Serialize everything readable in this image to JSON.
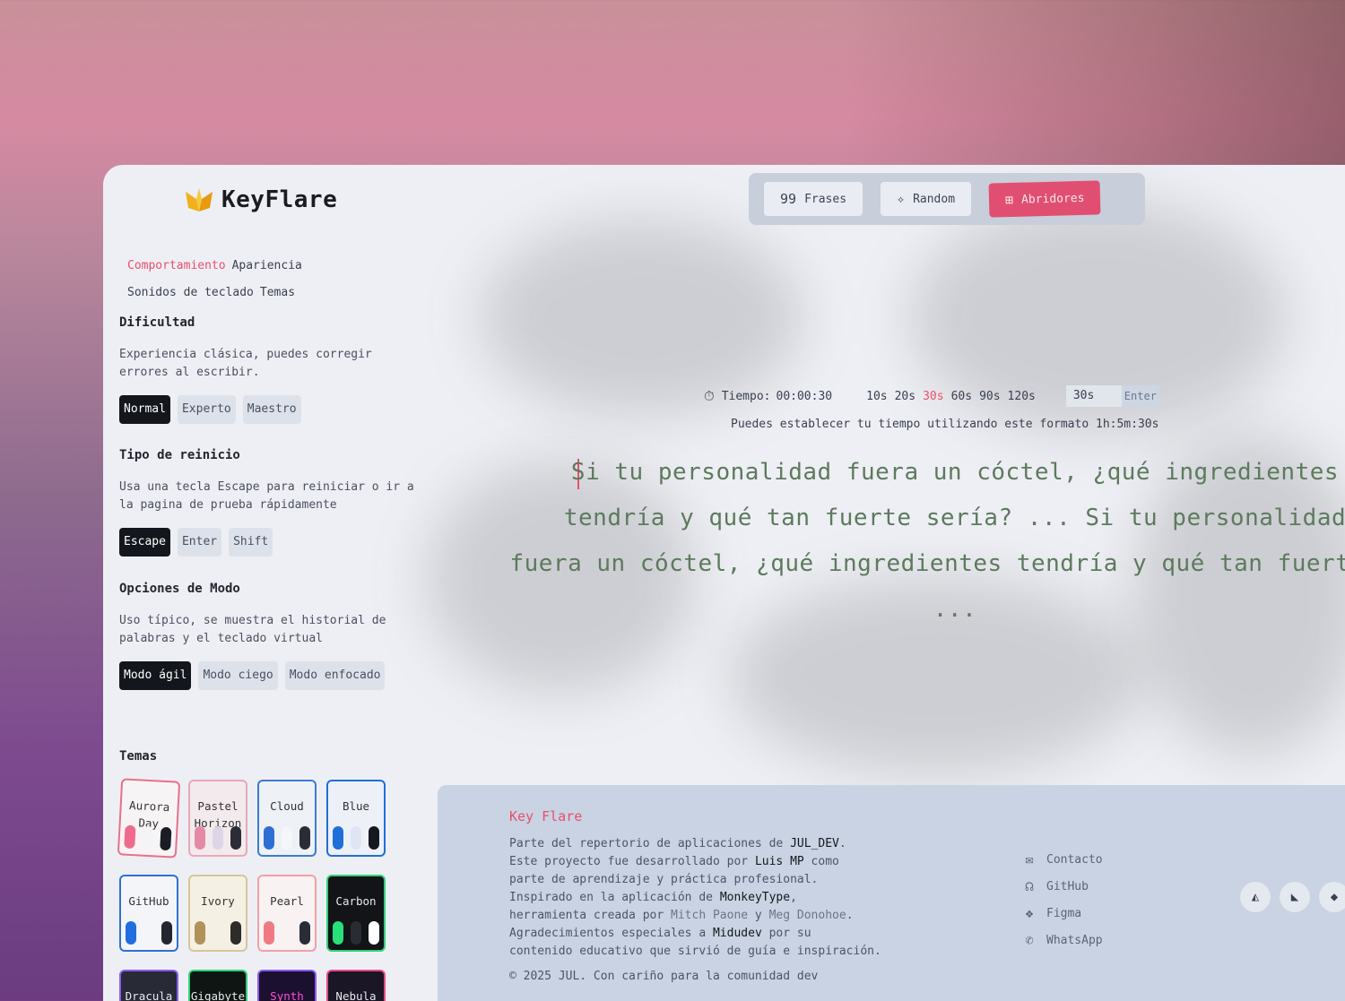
{
  "app": {
    "name": "KeyFlare"
  },
  "settings_nav": {
    "items": [
      "Comportamiento",
      "Apariencia",
      "Sonidos de teclado",
      "Temas"
    ],
    "active": "Comportamiento"
  },
  "difficulty": {
    "title": "Dificultad",
    "description": "Experiencia clásica, puedes corregir errores al escribir.",
    "options": [
      "Normal",
      "Experto",
      "Maestro"
    ],
    "selected": "Normal"
  },
  "restart": {
    "title": "Tipo de reinicio",
    "description": "Usa una tecla Escape para reiniciar o ir a la pagina de prueba rápidamente",
    "options": [
      "Escape",
      "Enter",
      "Shift"
    ],
    "selected": "Escape"
  },
  "mode_options": {
    "title": "Opciones de Modo",
    "description": "Uso típico, se muestra el historial de palabras y el teclado virtual",
    "options": [
      "Modo ágil",
      "Modo ciego",
      "Modo enfocado"
    ],
    "selected": "Modo ágil"
  },
  "themes": {
    "title": "Temas",
    "items": [
      {
        "name": "Aurora Day",
        "border": "#e8708a",
        "bg": "#f7f4f6",
        "swatches": [
          "#ef6b8e",
          "#f4f4f6",
          "#1b1d24"
        ]
      },
      {
        "name": "Pastel Horizon",
        "border": "#e8a8b8",
        "bg": "#f3eaee",
        "swatches": [
          "#e58aa6",
          "#dcd6e6",
          "#2a2c36"
        ]
      },
      {
        "name": "Cloud",
        "border": "#3a7bd5",
        "bg": "#eef1f6",
        "swatches": [
          "#2f6fd4",
          "#f4f6fa",
          "#2a2c36"
        ]
      },
      {
        "name": "Blue",
        "border": "#1e6fd9",
        "bg": "#edf0f7",
        "swatches": [
          "#1e6fd9",
          "#dfe5f2",
          "#16181f"
        ]
      },
      {
        "name": "GitHub",
        "border": "#2f6fd4",
        "bg": "#f3f5f8",
        "swatches": [
          "#1f6fe0",
          "#f3f5f8",
          "#23262e"
        ]
      },
      {
        "name": "Ivory",
        "border": "#d5c69a",
        "bg": "#f4f0e4",
        "swatches": [
          "#b0925a",
          "#f4f0e4",
          "#2d2c2a"
        ]
      },
      {
        "name": "Pearl",
        "border": "#f0a0a8",
        "bg": "#f8f2f2",
        "swatches": [
          "#f07a84",
          "#f8f2f2",
          "#2a2c36"
        ]
      },
      {
        "name": "Carbon",
        "border": "#2fd27a",
        "bg": "#121418",
        "swatches": [
          "#28e07a",
          "#2a2c34",
          "#ffffff"
        ]
      },
      {
        "name": "Dracula",
        "border": "#8a5cf0",
        "bg": "#282a36",
        "swatches": [
          "#bd93f9",
          "#44475a",
          "#f8f8f2"
        ]
      },
      {
        "name": "Gigabyte",
        "border": "#2fd27a",
        "bg": "#0e1512",
        "swatches": [
          "#28e07a",
          "#1a2a22",
          "#ffffff"
        ]
      },
      {
        "name": "Synth",
        "border": "#8a5cf0",
        "bg": "#1b1030",
        "swatches": [
          "#ff4fd8",
          "#2b1d4a",
          "#9b6bff"
        ]
      },
      {
        "name": "Nebula",
        "border": "#e84a8a",
        "bg": "#1a1626",
        "swatches": [
          "#ff5d9e",
          "#2c2440",
          "#ffffff"
        ]
      }
    ]
  },
  "modes": {
    "items": [
      {
        "label": "Frases",
        "icon": "quote-icon",
        "glyph": "99"
      },
      {
        "label": "Random",
        "icon": "sparkle-icon",
        "glyph": "✧"
      },
      {
        "label": "Abridores",
        "icon": "jar-icon",
        "glyph": "⊞"
      }
    ],
    "active": "Abridores"
  },
  "timer": {
    "label": "Tiempo:",
    "value": "00:00:30",
    "options": [
      "10s",
      "20s",
      "30s",
      "60s",
      "90s",
      "120s"
    ],
    "selected": "30s",
    "input_value": "30s",
    "enter_label": "Enter",
    "hint": "Puedes establecer tu tiempo utilizando este formato 1h:5m:30s"
  },
  "typing": {
    "lines": [
      "Si tu personalidad fuera un cóctel, ¿qué ingredientes",
      "tendría y qué tan fuerte sería? ... Si tu personalidad",
      "fuera un cóctel, ¿qué ingredientes tendría y qué tan fuerte",
      "..."
    ]
  },
  "footer": {
    "brand": "Key Flare",
    "desc": {
      "l1a": "Parte del repertorio de aplicaciones de ",
      "l1b": "JUL_DEV",
      "l1c": ".",
      "l2a": "Este proyecto fue desarrollado por ",
      "l2b": "Luis MP",
      "l2c": " como",
      "l3": "parte de aprendizaje y práctica profesional.",
      "l4a": "Inspirado en la aplicación de ",
      "l4b": "MonkeyType",
      "l4c": ",",
      "l5a": "herramienta creada por ",
      "l5b": "Mitch Paone",
      "l5c": " y ",
      "l5d": "Meg Donohoe",
      "l5e": ".",
      "l6a": "Agradecimientos especiales a ",
      "l6b": "Midudev",
      "l6c": " por su",
      "l7": "contenido educativo que sirvió de guía e inspiración."
    },
    "copyright": "© 2025 JUL. Con cariño para la comunidad dev",
    "links": [
      {
        "label": "Contacto",
        "icon": "mail-icon",
        "glyph": "✉"
      },
      {
        "label": "GitHub",
        "icon": "github-icon",
        "glyph": "☊"
      },
      {
        "label": "Figma",
        "icon": "figma-icon",
        "glyph": "❖"
      },
      {
        "label": "WhatsApp",
        "icon": "whatsapp-icon",
        "glyph": "✆"
      }
    ],
    "social": [
      {
        "icon": "wolf-icon",
        "glyph": "◭"
      },
      {
        "icon": "keyflare-logo-icon",
        "glyph": "◣"
      },
      {
        "icon": "code-icon",
        "glyph": "◆"
      }
    ]
  }
}
